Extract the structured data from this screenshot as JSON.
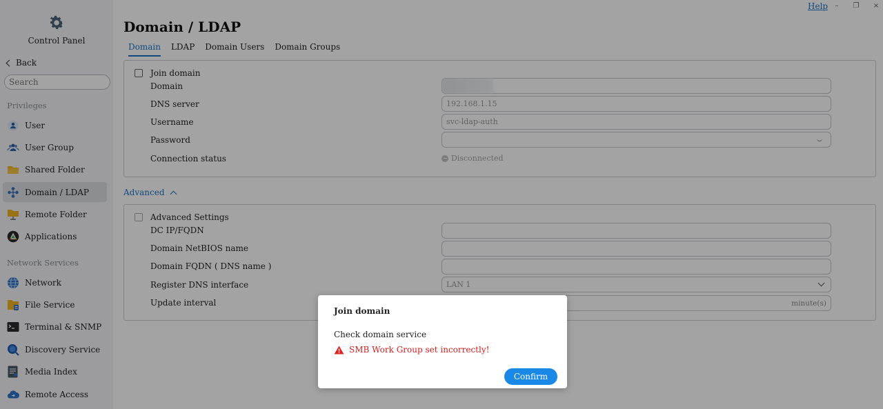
{
  "sidebar": {
    "title": "Control Panel",
    "back_label": "Back",
    "search_placeholder": "Search",
    "sections": {
      "privileges": "Privileges",
      "network_services": "Network Services"
    },
    "items": [
      {
        "label": "User",
        "icon": "user-icon"
      },
      {
        "label": "User Group",
        "icon": "user-group-icon"
      },
      {
        "label": "Shared Folder",
        "icon": "folder-icon"
      },
      {
        "label": "Domain / LDAP",
        "icon": "domain-ldap-icon",
        "active": true
      },
      {
        "label": "Remote Folder",
        "icon": "remote-folder-icon"
      },
      {
        "label": "Applications",
        "icon": "applications-icon"
      },
      {
        "label": "Network",
        "icon": "network-globe-icon"
      },
      {
        "label": "File Service",
        "icon": "file-service-icon"
      },
      {
        "label": "Terminal & SNMP",
        "icon": "terminal-icon"
      },
      {
        "label": "Discovery Service",
        "icon": "discovery-icon"
      },
      {
        "label": "Media Index",
        "icon": "media-index-icon"
      },
      {
        "label": "Remote Access",
        "icon": "remote-access-cloud-icon"
      }
    ]
  },
  "topbar": {
    "help": "Help",
    "minimize": "–",
    "restore": "❐",
    "close": "×"
  },
  "page": {
    "title": "Domain / LDAP",
    "tabs": [
      "Domain",
      "LDAP",
      "Domain Users",
      "Domain Groups"
    ],
    "active_tab": "Domain"
  },
  "domain_panel": {
    "join_domain": "Join domain",
    "domain_label": "Domain",
    "domain_value": "",
    "dns_label": "DNS server",
    "dns_value": "192.168.1.15",
    "username_label": "Username",
    "username_value": "svc-ldap-auth",
    "password_label": "Password",
    "password_value": "",
    "status_label": "Connection status",
    "status_value": "Disconnected"
  },
  "advanced": {
    "toggle_label": "Advanced",
    "settings_label": "Advanced Settings",
    "dc_label": "DC IP/FQDN",
    "netbios_label": "Domain NetBIOS name",
    "fqdn_label": "Domain FQDN ( DNS name )",
    "register_dns_label": "Register DNS interface",
    "register_dns_value": "LAN 1",
    "interval_label": "Update interval",
    "interval_unit": "minute(s)"
  },
  "modal": {
    "title": "Join domain",
    "message": "Check domain service",
    "error": "SMB Work Group set incorrectly!",
    "confirm": "Confirm"
  },
  "colors": {
    "accent": "#1a73c9",
    "button": "#1a88e6",
    "error": "#d42020"
  }
}
